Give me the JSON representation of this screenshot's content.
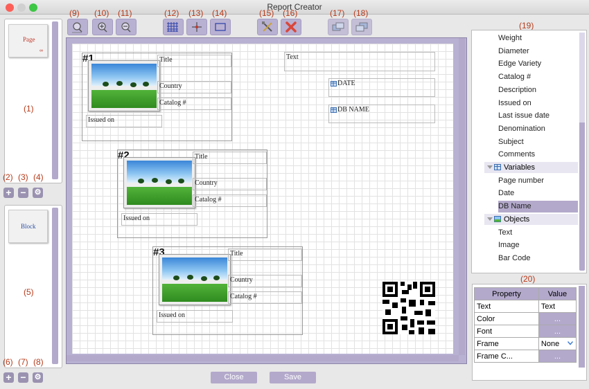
{
  "window": {
    "title": "Report Creator"
  },
  "annotations": {
    "a1": "(1)",
    "a2": "(2)",
    "a3": "(3)",
    "a4": "(4)",
    "a5": "(5)",
    "a6": "(6)",
    "a7": "(7)",
    "a8": "(8)",
    "a9": "(9)",
    "a10": "(10)",
    "a11": "(11)",
    "a12": "(12)",
    "a13": "(13)",
    "a14": "(14)",
    "a15": "(15)",
    "a16": "(16)",
    "a17": "(17)",
    "a18": "(18)",
    "a19": "(19)",
    "a20": "(20)"
  },
  "thumbs": {
    "page_label": "Page",
    "page_sub": "∞",
    "block_label": "Block"
  },
  "panel_buttons": {
    "add": "+",
    "remove": "−",
    "settings": "⚙"
  },
  "canvas": {
    "blocks": [
      {
        "badge": "#1",
        "title": "Title",
        "country": "Country",
        "catalog": "Catalog #",
        "issued": "Issued on"
      },
      {
        "badge": "#2",
        "title": "Title",
        "country": "Country",
        "catalog": "Catalog #",
        "issued": "Issued on"
      },
      {
        "badge": "#3",
        "title": "Title",
        "country": "Country",
        "catalog": "Catalog #",
        "issued": "Issued on"
      }
    ],
    "text_field": "Text",
    "date_field": "DATE",
    "dbname_field": "DB NAME"
  },
  "fields_list": {
    "items": [
      "Weight",
      "Diameter",
      "Edge Variety",
      "Catalog #",
      "Description",
      "Issued on",
      "Last issue date",
      "Denomination",
      "Subject",
      "Comments"
    ],
    "group_variables": "Variables",
    "variables": [
      "Page number",
      "Date",
      "DB Name"
    ],
    "group_objects": "Objects",
    "objects": [
      "Text",
      "Image",
      "Bar Code"
    ]
  },
  "properties": {
    "header_property": "Property",
    "header_value": "Value",
    "rows": [
      {
        "name": "Text",
        "value": "Text"
      },
      {
        "name": "Color",
        "value": "..."
      },
      {
        "name": "Font",
        "value": "..."
      },
      {
        "name": "Frame",
        "value": "None"
      },
      {
        "name": "Frame C...",
        "value": "..."
      }
    ]
  },
  "buttons": {
    "close": "Close",
    "save": "Save"
  },
  "colors": {
    "accent": "#b3a9cb",
    "annotation": "#b63a1a",
    "delete": "#d9463a"
  }
}
